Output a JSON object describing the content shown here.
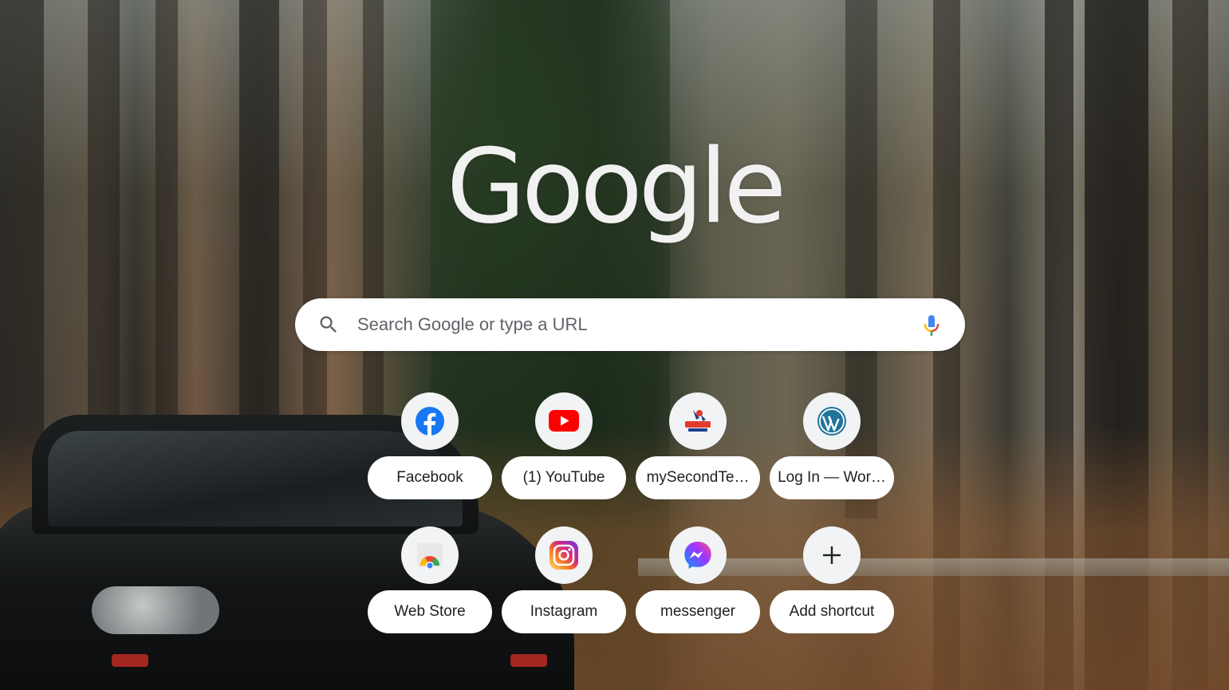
{
  "logo": {
    "text": "Google"
  },
  "search": {
    "placeholder": "Search Google or type a URL",
    "value": ""
  },
  "icons": {
    "search": "search-icon",
    "mic": "microphone-icon"
  },
  "shortcuts": [
    {
      "label": "Facebook",
      "icon": "facebook-icon"
    },
    {
      "label": "(1) YouTube",
      "icon": "youtube-icon"
    },
    {
      "label": "mySecondTe…",
      "icon": "mysecondteacher-icon"
    },
    {
      "label": "Log In — Wor…",
      "icon": "wordpress-icon"
    },
    {
      "label": "Web Store",
      "icon": "chrome-web-store-icon"
    },
    {
      "label": "Instagram",
      "icon": "instagram-icon"
    },
    {
      "label": "messenger",
      "icon": "messenger-icon"
    },
    {
      "label": "Add shortcut",
      "icon": "plus-icon"
    }
  ],
  "colors": {
    "facebook": "#1877f2",
    "youtube": "#ff0000",
    "wordpress": "#21759b",
    "mic_blue": "#4285f4",
    "mic_red": "#ea4335",
    "mic_yellow": "#fbbc04",
    "mic_green": "#34a853"
  }
}
